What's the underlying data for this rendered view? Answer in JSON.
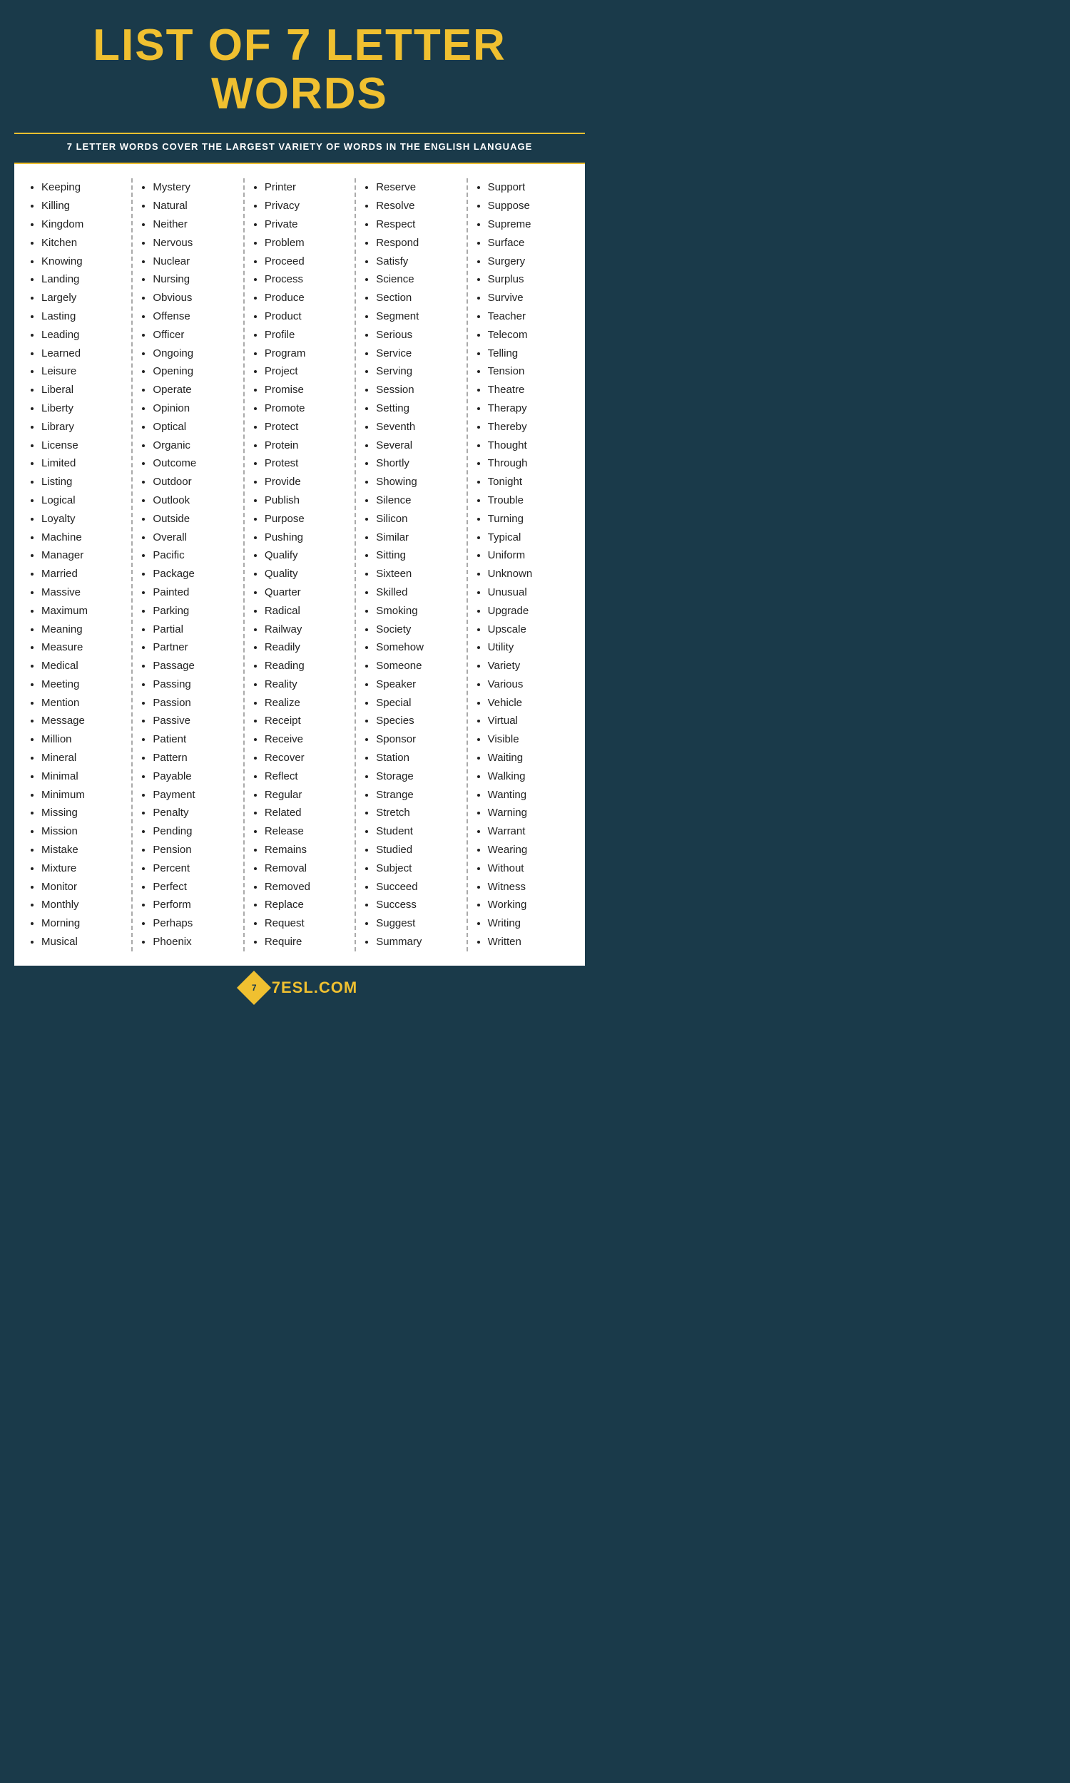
{
  "header": {
    "title": "LIST OF 7 LETTER WORDS",
    "subtitle": "7 LETTER WORDS COVER THE LARGEST VARIETY OF WORDS IN THE ENGLISH LANGUAGE"
  },
  "columns": [
    {
      "words": [
        "Keeping",
        "Killing",
        "Kingdom",
        "Kitchen",
        "Knowing",
        "Landing",
        "Largely",
        "Lasting",
        "Leading",
        "Learned",
        "Leisure",
        "Liberal",
        "Liberty",
        "Library",
        "License",
        "Limited",
        "Listing",
        "Logical",
        "Loyalty",
        "Machine",
        "Manager",
        "Married",
        "Massive",
        "Maximum",
        "Meaning",
        "Measure",
        "Medical",
        "Meeting",
        "Mention",
        "Message",
        "Million",
        "Mineral",
        "Minimal",
        "Minimum",
        "Missing",
        "Mission",
        "Mistake",
        "Mixture",
        "Monitor",
        "Monthly",
        "Morning",
        "Musical"
      ]
    },
    {
      "words": [
        "Mystery",
        "Natural",
        "Neither",
        "Nervous",
        "Nuclear",
        "Nursing",
        "Obvious",
        "Offense",
        "Officer",
        "Ongoing",
        "Opening",
        "Operate",
        "Opinion",
        "Optical",
        "Organic",
        "Outcome",
        "Outdoor",
        "Outlook",
        "Outside",
        "Overall",
        "Pacific",
        "Package",
        "Painted",
        "Parking",
        "Partial",
        "Partner",
        "Passage",
        "Passing",
        "Passion",
        "Passive",
        "Patient",
        "Pattern",
        "Payable",
        "Payment",
        "Penalty",
        "Pending",
        "Pension",
        "Percent",
        "Perfect",
        "Perform",
        "Perhaps",
        "Phoenix"
      ]
    },
    {
      "words": [
        "Printer",
        "Privacy",
        "Private",
        "Problem",
        "Proceed",
        "Process",
        "Produce",
        "Product",
        "Profile",
        "Program",
        "Project",
        "Promise",
        "Promote",
        "Protect",
        "Protein",
        "Protest",
        "Provide",
        "Publish",
        "Purpose",
        "Pushing",
        "Qualify",
        "Quality",
        "Quarter",
        "Radical",
        "Railway",
        "Readily",
        "Reading",
        "Reality",
        "Realize",
        "Receipt",
        "Receive",
        "Recover",
        "Reflect",
        "Regular",
        "Related",
        "Release",
        "Remains",
        "Removal",
        "Removed",
        "Replace",
        "Request",
        "Require"
      ]
    },
    {
      "words": [
        "Reserve",
        "Resolve",
        "Respect",
        "Respond",
        "Satisfy",
        "Science",
        "Section",
        "Segment",
        "Serious",
        "Service",
        "Serving",
        "Session",
        "Setting",
        "Seventh",
        "Several",
        "Shortly",
        "Showing",
        "Silence",
        "Silicon",
        "Similar",
        "Sitting",
        "Sixteen",
        "Skilled",
        "Smoking",
        "Society",
        "Somehow",
        "Someone",
        "Speaker",
        "Special",
        "Species",
        "Sponsor",
        "Station",
        "Storage",
        "Strange",
        "Stretch",
        "Student",
        "Studied",
        "Subject",
        "Succeed",
        "Success",
        "Suggest",
        "Summary"
      ]
    },
    {
      "words": [
        "Support",
        "Suppose",
        "Supreme",
        "Surface",
        "Surgery",
        "Surplus",
        "Survive",
        "Teacher",
        "Telecom",
        "Telling",
        "Tension",
        "Theatre",
        "Therapy",
        "Thereby",
        "Thought",
        "Through",
        "Tonight",
        "Trouble",
        "Turning",
        "Typical",
        "Uniform",
        "Unknown",
        "Unusual",
        "Upgrade",
        "Upscale",
        "Utility",
        "Variety",
        "Various",
        "Vehicle",
        "Virtual",
        "Visible",
        "Waiting",
        "Walking",
        "Wanting",
        "Warning",
        "Warrant",
        "Wearing",
        "Without",
        "Witness",
        "Working",
        "Writing",
        "Written"
      ]
    }
  ],
  "footer": {
    "logo_text": "7ESL.COM",
    "logo_symbol": "7"
  }
}
